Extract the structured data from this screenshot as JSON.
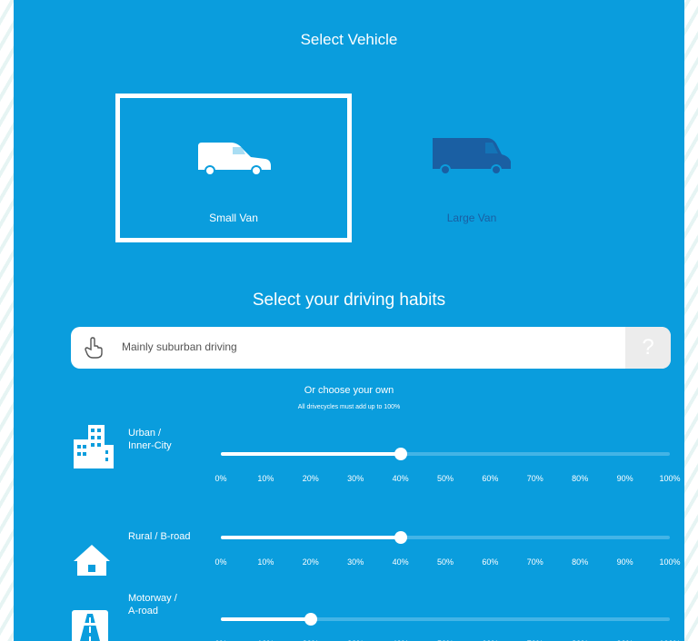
{
  "page": {
    "title": "Select Vehicle",
    "vehicles": [
      {
        "label": "Small Van",
        "selected": true,
        "icon": "small-van-icon",
        "color": "#ffffff"
      },
      {
        "label": "Large Van",
        "selected": false,
        "icon": "large-van-icon",
        "color": "#1a5fa3"
      }
    ],
    "habits_title": "Select your driving habits",
    "dropdown": {
      "value": "Mainly suburban driving",
      "help_label": "?",
      "icon": "hand-pointer-icon"
    },
    "choose_own": "Or choose your own",
    "choose_own_sub": "All drivecycles must add up to 100%",
    "ticks": [
      "0%",
      "10%",
      "20%",
      "30%",
      "40%",
      "50%",
      "60%",
      "70%",
      "80%",
      "90%",
      "100%"
    ],
    "sliders": [
      {
        "label": "Urban /\nInner-City",
        "value_percent": 40,
        "icon": "city-buildings-icon"
      },
      {
        "label": "Rural / B-road",
        "value_percent": 40,
        "icon": "house-icon"
      },
      {
        "label": "Motorway /\nA-road",
        "value_percent": 20,
        "icon": "motorway-icon"
      }
    ]
  },
  "colors": {
    "panel_bg": "#0a9ddd",
    "track": "#43b4e6",
    "fill": "#ffffff"
  }
}
